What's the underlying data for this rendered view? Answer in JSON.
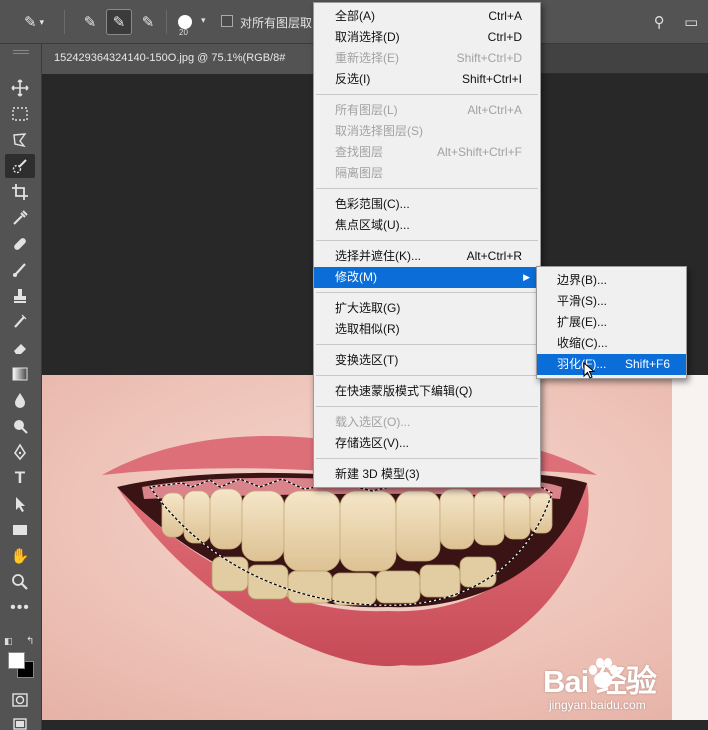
{
  "options_bar": {
    "brush_size": "20",
    "sample_all_layers_label": "对所有图层取"
  },
  "document": {
    "tab_title": "152429364324140-150O.jpg @ 75.1%(RGB/8#"
  },
  "select_menu": {
    "groups": [
      [
        {
          "label": "全部(A)",
          "shortcut": "Ctrl+A",
          "disabled": false
        },
        {
          "label": "取消选择(D)",
          "shortcut": "Ctrl+D",
          "disabled": false
        },
        {
          "label": "重新选择(E)",
          "shortcut": "Shift+Ctrl+D",
          "disabled": true
        },
        {
          "label": "反选(I)",
          "shortcut": "Shift+Ctrl+I",
          "disabled": false
        }
      ],
      [
        {
          "label": "所有图层(L)",
          "shortcut": "Alt+Ctrl+A",
          "disabled": true
        },
        {
          "label": "取消选择图层(S)",
          "shortcut": "",
          "disabled": true
        },
        {
          "label": "查找图层",
          "shortcut": "Alt+Shift+Ctrl+F",
          "disabled": true
        },
        {
          "label": "隔离图层",
          "shortcut": "",
          "disabled": true
        }
      ],
      [
        {
          "label": "色彩范围(C)...",
          "shortcut": "",
          "disabled": false
        },
        {
          "label": "焦点区域(U)...",
          "shortcut": "",
          "disabled": false
        }
      ],
      [
        {
          "label": "选择并遮住(K)...",
          "shortcut": "Alt+Ctrl+R",
          "disabled": false
        },
        {
          "label": "修改(M)",
          "shortcut": "",
          "disabled": false,
          "highlighted": true,
          "submenu": true
        }
      ],
      [
        {
          "label": "扩大选取(G)",
          "shortcut": "",
          "disabled": false
        },
        {
          "label": "选取相似(R)",
          "shortcut": "",
          "disabled": false
        }
      ],
      [
        {
          "label": "变换选区(T)",
          "shortcut": "",
          "disabled": false
        }
      ],
      [
        {
          "label": "在快速蒙版模式下编辑(Q)",
          "shortcut": "",
          "disabled": false
        }
      ],
      [
        {
          "label": "载入选区(O)...",
          "shortcut": "",
          "disabled": true
        },
        {
          "label": "存储选区(V)...",
          "shortcut": "",
          "disabled": false
        }
      ],
      [
        {
          "label": "新建 3D 模型(3)",
          "shortcut": "",
          "disabled": false
        }
      ]
    ]
  },
  "modify_menu": {
    "items": [
      {
        "label": "边界(B)...",
        "shortcut": ""
      },
      {
        "label": "平滑(S)...",
        "shortcut": ""
      },
      {
        "label": "扩展(E)...",
        "shortcut": ""
      },
      {
        "label": "收缩(C)...",
        "shortcut": ""
      },
      {
        "label": "羽化(F)...",
        "shortcut": "Shift+F6",
        "highlighted": true
      }
    ]
  },
  "watermark": {
    "text": "Bai 经验",
    "url": "jingyan.baidu.com"
  },
  "colors": {
    "menu_highlight": "#0a6dd8",
    "panel_bg": "#535353",
    "canvas_bg": "#282828"
  }
}
